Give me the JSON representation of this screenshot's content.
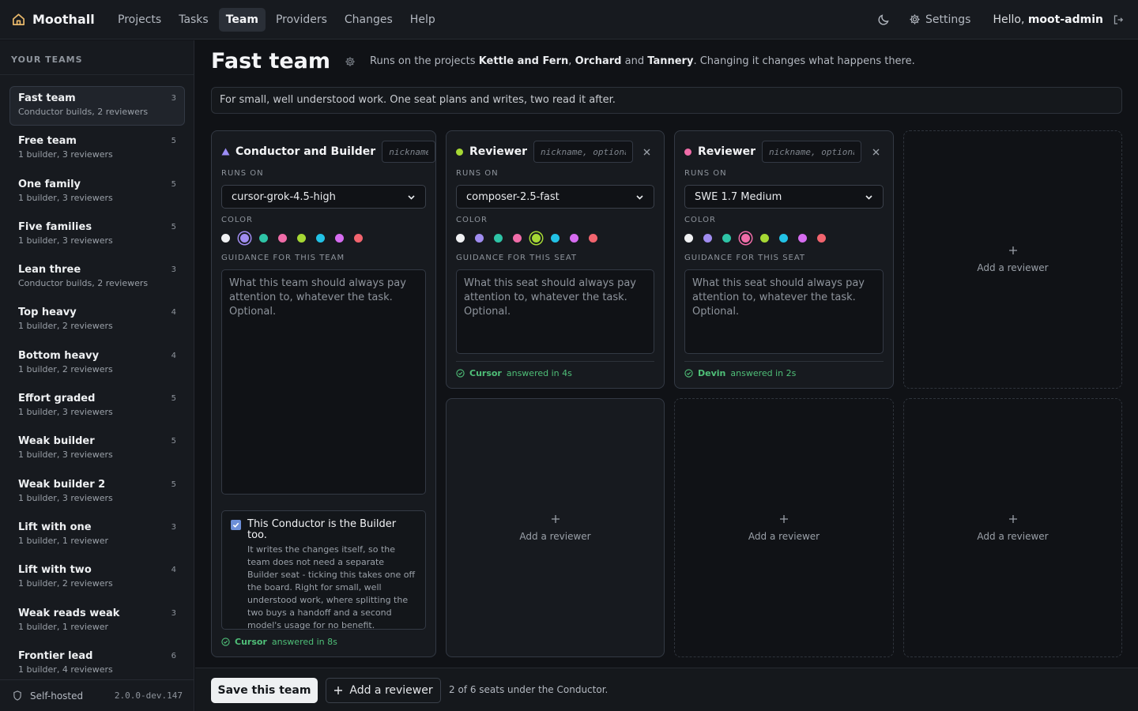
{
  "app": {
    "name": "Moothall"
  },
  "nav": {
    "items": [
      {
        "label": "Projects",
        "active": false
      },
      {
        "label": "Tasks",
        "active": false
      },
      {
        "label": "Team",
        "active": true
      },
      {
        "label": "Providers",
        "active": false
      },
      {
        "label": "Changes",
        "active": false
      },
      {
        "label": "Help",
        "active": false
      }
    ],
    "settings_label": "Settings",
    "greeting": "Hello,",
    "username": "moot-admin"
  },
  "sidebar": {
    "heading": "YOUR TEAMS",
    "teams": [
      {
        "name": "Fast team",
        "desc": "Conductor builds, 2 reviewers",
        "count": "3",
        "active": true
      },
      {
        "name": "Free team",
        "desc": "1 builder, 3 reviewers",
        "count": "5"
      },
      {
        "name": "One family",
        "desc": "1 builder, 3 reviewers",
        "count": "5"
      },
      {
        "name": "Five families",
        "desc": "1 builder, 3 reviewers",
        "count": "5"
      },
      {
        "name": "Lean three",
        "desc": "Conductor builds, 2 reviewers",
        "count": "3"
      },
      {
        "name": "Top heavy",
        "desc": "1 builder, 2 reviewers",
        "count": "4"
      },
      {
        "name": "Bottom heavy",
        "desc": "1 builder, 2 reviewers",
        "count": "4"
      },
      {
        "name": "Effort graded",
        "desc": "1 builder, 3 reviewers",
        "count": "5"
      },
      {
        "name": "Weak builder",
        "desc": "1 builder, 3 reviewers",
        "count": "5"
      },
      {
        "name": "Weak builder 2",
        "desc": "1 builder, 3 reviewers",
        "count": "5"
      },
      {
        "name": "Lift with one",
        "desc": "1 builder, 1 reviewer",
        "count": "3"
      },
      {
        "name": "Lift with two",
        "desc": "1 builder, 2 reviewers",
        "count": "4"
      },
      {
        "name": "Weak reads weak",
        "desc": "1 builder, 1 reviewer",
        "count": "3"
      },
      {
        "name": "Frontier lead",
        "desc": "1 builder, 4 reviewers",
        "count": "6"
      }
    ],
    "footer_label": "Self-hosted",
    "version": "2.0.0-dev.147"
  },
  "page": {
    "title": "Fast team",
    "runs_on_prefix": "Runs on the projects",
    "project_1": "Kettle and Fern",
    "sep_1": ",",
    "project_2": "Orchard",
    "sep_2": "and",
    "project_3": "Tannery",
    "runs_on_suffix": ". Changing it changes what happens there.",
    "description": "For small, well understood work. One seat plans and writes, two read it after."
  },
  "palette": [
    "#f0f1f3",
    "#a08cf0",
    "#2ec4a6",
    "#f06ca8",
    "#a6d834",
    "#22c2e6",
    "#d66cf0",
    "#f2646e"
  ],
  "seats": [
    {
      "role": "Conductor and Builder",
      "role_color": "#9b8cf5",
      "nickname_placeholder": "nickname, optional",
      "runs_on_label": "RUNS ON",
      "model": "cursor-grok-4.5-high",
      "color_label": "COLOR",
      "selected_color": "#a08cf0",
      "guidance_label": "GUIDANCE FOR THIS TEAM",
      "guidance_placeholder": "What this team should always pay attention to, whatever the task. Optional.",
      "builder_checked": true,
      "builder_title": "This Conductor is the Builder too.",
      "builder_text": "It writes the changes itself, so the team does not need a separate Builder seat - ticking this takes one off the board. Right for small, well understood work, where splitting the two buys a handoff and a second model's usage for no benefit.",
      "answer_provider": "Cursor",
      "answer_text": "answered in 8s"
    },
    {
      "role": "Reviewer",
      "role_color": "#a6d834",
      "nickname_placeholder": "nickname, optional",
      "runs_on_label": "RUNS ON",
      "model": "composer-2.5-fast",
      "color_label": "COLOR",
      "selected_color": "#a6d834",
      "guidance_label": "GUIDANCE FOR THIS SEAT",
      "guidance_placeholder": "What this seat should always pay attention to, whatever the task. Optional.",
      "answer_provider": "Cursor",
      "answer_text": "answered in 4s"
    },
    {
      "role": "Reviewer",
      "role_color": "#f06ca8",
      "nickname_placeholder": "nickname, optional",
      "runs_on_label": "RUNS ON",
      "model": "SWE 1.7 Medium",
      "color_label": "COLOR",
      "selected_color": "#f06ca8",
      "guidance_label": "GUIDANCE FOR THIS SEAT",
      "guidance_placeholder": "What this seat should always pay attention to, whatever the task. Optional.",
      "answer_provider": "Devin",
      "answer_text": "answered in 2s"
    }
  ],
  "add_slot_label": "Add a reviewer",
  "footer": {
    "save_label": "Save this team",
    "add_reviewer_label": "Add a reviewer",
    "seats_note": "2 of 6 seats under the Conductor."
  }
}
